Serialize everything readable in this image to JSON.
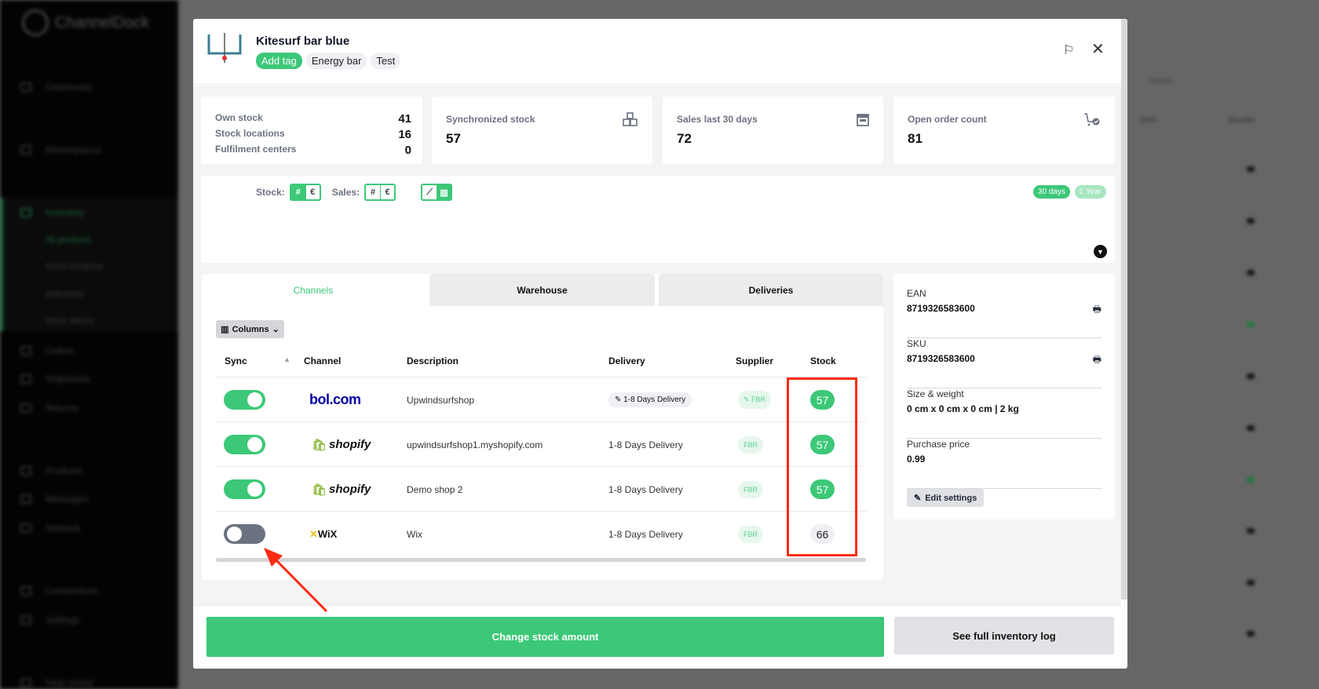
{
  "background": {
    "logo": "ChannelDock",
    "sidebar": {
      "items": [
        {
          "label": "Dashboard"
        },
        {
          "label": "Marketplaces"
        },
        {
          "label": "Inventory"
        },
        {
          "label": "Orders"
        },
        {
          "label": "Shipments"
        },
        {
          "label": "Returns"
        },
        {
          "label": "Products"
        },
        {
          "label": "Messages"
        },
        {
          "label": "Network"
        },
        {
          "label": "Connections"
        },
        {
          "label": "Settings"
        },
        {
          "label": "Help center"
        }
      ],
      "sub_items": [
        {
          "label": "All products"
        },
        {
          "label": "Stock locations"
        },
        {
          "label": "Deliveries"
        },
        {
          "label": "Stock advice"
        }
      ]
    },
    "table": {
      "search_placeholder": "Search",
      "col_ean": "EAN",
      "col_bundle": "Bundle"
    }
  },
  "modal": {
    "title": "Kitesurf bar blue",
    "tags": [
      {
        "label": "Add tag"
      },
      {
        "label": "Energy bar"
      },
      {
        "label": "Test"
      }
    ],
    "stats": {
      "own_stock": {
        "label": "Own stock",
        "value": "41"
      },
      "stock_locations": {
        "label": "Stock locations",
        "value": "16"
      },
      "fulfilment_centers": {
        "label": "Fulfilment centers",
        "value": "0"
      },
      "synchronized": {
        "label": "Synchronized stock",
        "value": "57",
        "icon": "boxes-icon"
      },
      "sales": {
        "label": "Sales last 30 days",
        "value": "72",
        "icon": "calendar-icon"
      },
      "open_orders": {
        "label": "Open order count",
        "value": "81",
        "icon": "cart-check-icon"
      }
    },
    "chart_controls": {
      "stock_label": "Stock:",
      "sales_label": "Sales:",
      "count_symbol": "#",
      "currency_symbol": "€",
      "range_30": "30 days",
      "range_year": "1 Year"
    },
    "tabs": [
      {
        "label": "Channels",
        "active": true
      },
      {
        "label": "Warehouse"
      },
      {
        "label": "Deliveries"
      }
    ],
    "columns_button": "Columns",
    "table": {
      "headers": [
        "Sync",
        "Channel",
        "Description",
        "Delivery",
        "Supplier",
        "Stock"
      ],
      "rows": [
        {
          "sync": true,
          "channel": "bol.com",
          "description": "Upwindsurfshop",
          "delivery": "1-8 Days Delivery",
          "delivery_editable": true,
          "supplier": "FBR",
          "stock": "57"
        },
        {
          "sync": true,
          "channel": "shopify",
          "description": "upwindsurfshop1.myshopify.com",
          "delivery": "1-8 Days Delivery",
          "supplier": "FBR",
          "stock": "57"
        },
        {
          "sync": true,
          "channel": "shopify",
          "description": "Demo shop 2",
          "delivery": "1-8 Days Delivery",
          "supplier": "FBR",
          "stock": "57"
        },
        {
          "sync": false,
          "channel": "WiX",
          "description": "Wix",
          "delivery": "1-8 Days Delivery",
          "supplier": "FBR",
          "stock": "66"
        }
      ]
    },
    "info": {
      "ean": {
        "label": "EAN",
        "value": "8719326583600"
      },
      "sku": {
        "label": "SKU",
        "value": "8719326583600"
      },
      "size": {
        "label": "Size & weight",
        "value": "0 cm x 0 cm x 0 cm | 2 kg"
      },
      "price": {
        "label": "Purchase price",
        "value": "0.99"
      },
      "edit_button": "Edit settings"
    },
    "footer": {
      "change_stock": "Change stock amount",
      "inventory_log": "See full inventory log"
    }
  },
  "colors": {
    "accent": "#3cc878",
    "annotation": "#ff2a12",
    "brand_bol": "#0000a4"
  }
}
